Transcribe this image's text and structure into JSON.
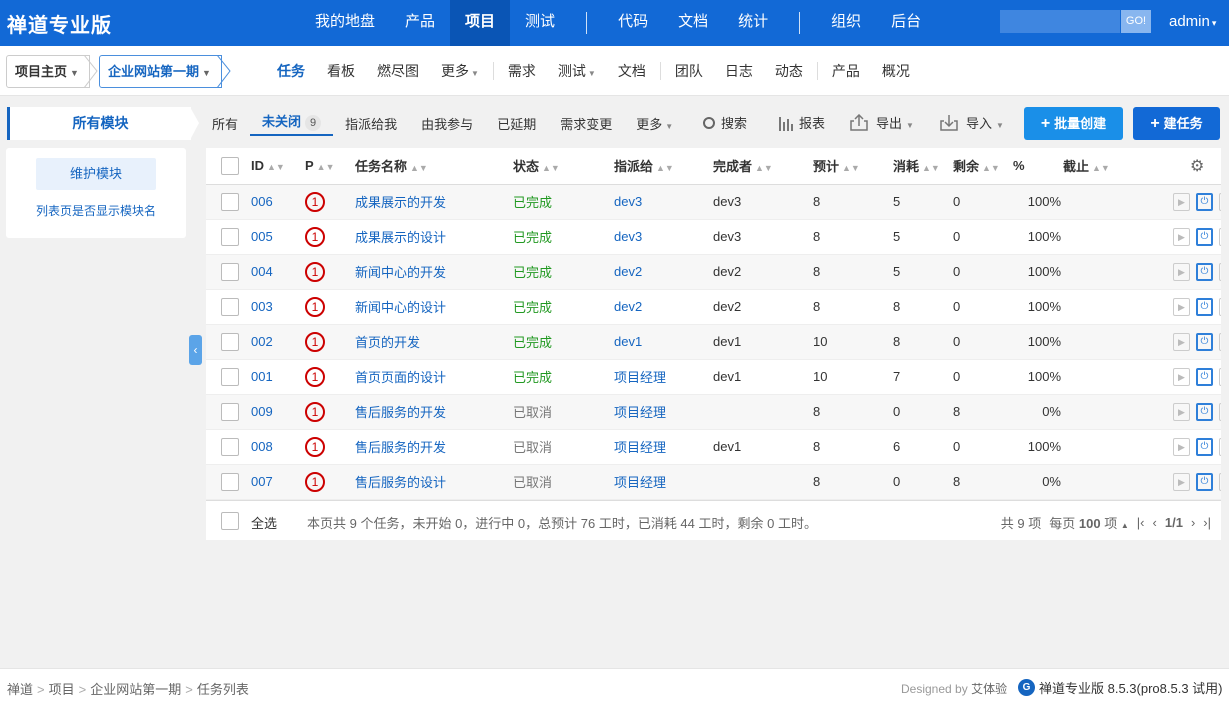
{
  "header": {
    "brand": "禅道专业版",
    "nav": [
      {
        "label": "我的地盘",
        "active": false
      },
      {
        "label": "产品",
        "active": false
      },
      {
        "label": "项目",
        "active": true
      },
      {
        "label": "测试",
        "active": false
      },
      {
        "label": "代码",
        "active": false
      },
      {
        "label": "文档",
        "active": false
      },
      {
        "label": "统计",
        "active": false
      },
      {
        "label": "组织",
        "active": false
      },
      {
        "label": "后台",
        "active": false
      }
    ],
    "search_go": "GO!",
    "user": "admin"
  },
  "subnav": {
    "crumb_home": "项目主页",
    "crumb_project": "企业网站第一期",
    "items": [
      "任务",
      "看板",
      "燃尽图",
      "更多",
      "需求",
      "测试",
      "文档",
      "团队",
      "日志",
      "动态",
      "产品",
      "概况"
    ]
  },
  "sidebar": {
    "module_title": "所有模块",
    "maintain_button": "维护模块",
    "show_module_link": "列表页是否显示模块名"
  },
  "featurebar": {
    "tabs": [
      {
        "label": "所有"
      },
      {
        "label": "未关闭",
        "count": "9",
        "active": true
      },
      {
        "label": "指派给我"
      },
      {
        "label": "由我参与"
      },
      {
        "label": "已延期"
      },
      {
        "label": "需求变更"
      },
      {
        "label": "更多"
      }
    ],
    "search": "搜索",
    "report": "报表",
    "export": "导出",
    "import": "导入",
    "batch_create": "批量创建",
    "create": "建任务"
  },
  "table": {
    "columns": [
      "ID",
      "P",
      "任务名称",
      "状态",
      "指派给",
      "完成者",
      "预计",
      "消耗",
      "剩余",
      "%",
      "截止"
    ],
    "rows": [
      {
        "id": "006",
        "pri": "1",
        "name": "成果展示的开发",
        "status": "已完成",
        "assigned": "dev3",
        "finished_by": "dev3",
        "estimate": "8",
        "consumed": "5",
        "left": "0",
        "progress": "100%",
        "deadline": ""
      },
      {
        "id": "005",
        "pri": "1",
        "name": "成果展示的设计",
        "status": "已完成",
        "assigned": "dev3",
        "finished_by": "dev3",
        "estimate": "8",
        "consumed": "5",
        "left": "0",
        "progress": "100%",
        "deadline": ""
      },
      {
        "id": "004",
        "pri": "1",
        "name": "新闻中心的开发",
        "status": "已完成",
        "assigned": "dev2",
        "finished_by": "dev2",
        "estimate": "8",
        "consumed": "5",
        "left": "0",
        "progress": "100%",
        "deadline": ""
      },
      {
        "id": "003",
        "pri": "1",
        "name": "新闻中心的设计",
        "status": "已完成",
        "assigned": "dev2",
        "finished_by": "dev2",
        "estimate": "8",
        "consumed": "8",
        "left": "0",
        "progress": "100%",
        "deadline": ""
      },
      {
        "id": "002",
        "pri": "1",
        "name": "首页的开发",
        "status": "已完成",
        "assigned": "dev1",
        "finished_by": "dev1",
        "estimate": "10",
        "consumed": "8",
        "left": "0",
        "progress": "100%",
        "deadline": ""
      },
      {
        "id": "001",
        "pri": "1",
        "name": "首页页面的设计",
        "status": "已完成",
        "assigned": "项目经理",
        "finished_by": "dev1",
        "estimate": "10",
        "consumed": "7",
        "left": "0",
        "progress": "100%",
        "deadline": ""
      },
      {
        "id": "009",
        "pri": "1",
        "name": "售后服务的开发",
        "status": "已取消",
        "assigned": "项目经理",
        "finished_by": "",
        "estimate": "8",
        "consumed": "0",
        "left": "8",
        "progress": "0%",
        "deadline": ""
      },
      {
        "id": "008",
        "pri": "1",
        "name": "售后服务的开发",
        "status": "已取消",
        "assigned": "项目经理",
        "finished_by": "dev1",
        "estimate": "8",
        "consumed": "6",
        "left": "0",
        "progress": "100%",
        "deadline": ""
      },
      {
        "id": "007",
        "pri": "1",
        "name": "售后服务的设计",
        "status": "已取消",
        "assigned": "项目经理",
        "finished_by": "",
        "estimate": "8",
        "consumed": "0",
        "left": "8",
        "progress": "0%",
        "deadline": ""
      }
    ],
    "footer": {
      "select_all": "全选",
      "summary": "本页共 9 个任务，未开始 0，进行中 0，总预计 76 工时，已消耗 44 工时，剩余 0 工时。",
      "total": "共 9 项",
      "per_page_prefix": "每页",
      "per_page_value": "100",
      "per_page_suffix": "项",
      "page": "1/1"
    }
  },
  "statusbar": {
    "breadcrumb": [
      "禅道",
      "项目",
      "企业网站第一期",
      "任务列表"
    ],
    "designed_by": "Designed by",
    "designer": "艾体验",
    "version": "禅道专业版 8.5.3(pro8.5.3 试用)"
  },
  "colors": {
    "primary": "#1269d6",
    "button": "#1a8fe8",
    "done": "#229922",
    "priority": "#cc0000"
  }
}
